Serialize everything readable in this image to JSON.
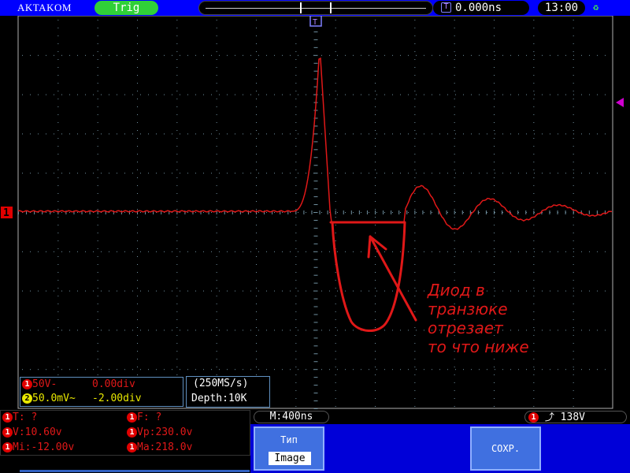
{
  "top_bar": {
    "brand": "AKTAKOM",
    "trigger_status": "Trig",
    "trigger_marker_icon": "T",
    "horizontal_position": "0.000ns",
    "clock": "13:00",
    "usb_icon": "usb-icon"
  },
  "screen": {
    "channel_marker": "1",
    "trigger_level_marker": "trigger-level-arrow",
    "annotation": [
      "Диод в",
      "транзюке",
      "отрезает",
      "то что ниже"
    ]
  },
  "channel_info": {
    "ch1": {
      "badge": "1",
      "scale": "50V-",
      "offset": "0.00div"
    },
    "ch2": {
      "badge": "2",
      "scale": "50.0mV~",
      "offset": "-2.00div"
    }
  },
  "sampling": {
    "rate": "(250MS/s)",
    "depth": "Depth:10K"
  },
  "measurements": {
    "t": {
      "badge": "1",
      "text": "T:  ?"
    },
    "f": {
      "badge": "1",
      "text": "F:  ?"
    },
    "v": {
      "badge": "1",
      "text": "V:10.60v"
    },
    "vp": {
      "badge": "1",
      "text": "Vp:230.0v"
    },
    "mi": {
      "badge": "1",
      "text": "Mi:-12.00v"
    },
    "ma": {
      "badge": "1",
      "text": "Ma:218.0v"
    }
  },
  "timebase": "M:400ns",
  "trigger": {
    "badge": "1",
    "level": "138V"
  },
  "softkeys": {
    "type_label": "Тип",
    "type_value": "Image",
    "save_label": "СОХР."
  },
  "colors": {
    "trace": "#e01818",
    "grid": "#7090a0",
    "top_bar": "#0000ff",
    "softkey": "#4070e0"
  }
}
